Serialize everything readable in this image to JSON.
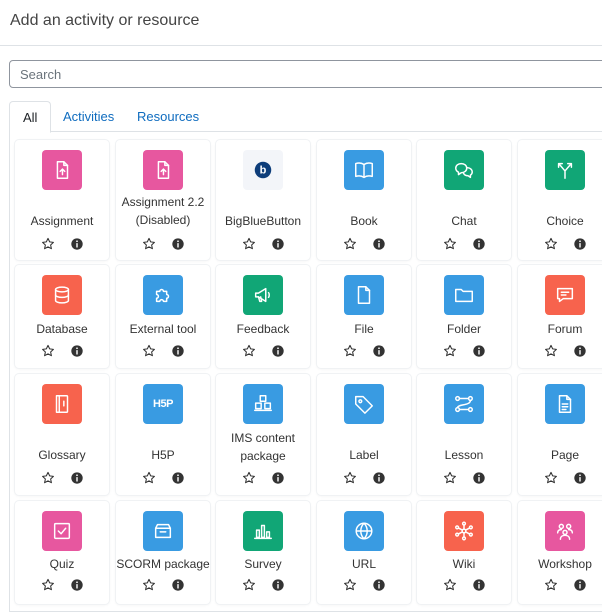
{
  "header": {
    "title": "Add an activity or resource"
  },
  "search": {
    "placeholder": "Search"
  },
  "tabs": [
    {
      "label": "All",
      "active": true
    },
    {
      "label": "Activities",
      "active": false
    },
    {
      "label": "Resources",
      "active": false
    }
  ],
  "colors": {
    "pink": "#e7579f",
    "blue": "#399be2",
    "green": "#11a676",
    "red": "#f7634d",
    "link": "#0f6cbf",
    "bbb": "#0d3d7a"
  },
  "modules": [
    {
      "label": "Assignment",
      "icon": "assignment-icon",
      "color": "pink"
    },
    {
      "label": "Assignment 2.2 (Disabled)",
      "icon": "assignment-icon",
      "color": "pink"
    },
    {
      "label": "BigBlueButton",
      "icon": "bigbluebutton-icon",
      "color": "bbb"
    },
    {
      "label": "Book",
      "icon": "book-icon",
      "color": "blue"
    },
    {
      "label": "Chat",
      "icon": "chat-icon",
      "color": "green"
    },
    {
      "label": "Choice",
      "icon": "choice-icon",
      "color": "green"
    },
    {
      "label": "Database",
      "icon": "database-icon",
      "color": "red"
    },
    {
      "label": "External tool",
      "icon": "puzzle-icon",
      "color": "blue"
    },
    {
      "label": "Feedback",
      "icon": "megaphone-icon",
      "color": "green"
    },
    {
      "label": "File",
      "icon": "file-icon",
      "color": "blue"
    },
    {
      "label": "Folder",
      "icon": "folder-icon",
      "color": "blue"
    },
    {
      "label": "Forum",
      "icon": "forum-icon",
      "color": "red"
    },
    {
      "label": "Glossary",
      "icon": "glossary-icon",
      "color": "red"
    },
    {
      "label": "H5P",
      "icon": "h5p-icon",
      "color": "blue",
      "icon_text": "H5P"
    },
    {
      "label": "IMS content package",
      "icon": "ims-package-icon",
      "color": "blue"
    },
    {
      "label": "Label",
      "icon": "tag-icon",
      "color": "blue"
    },
    {
      "label": "Lesson",
      "icon": "lesson-icon",
      "color": "blue"
    },
    {
      "label": "Page",
      "icon": "page-icon",
      "color": "blue"
    },
    {
      "label": "Quiz",
      "icon": "quiz-icon",
      "color": "pink"
    },
    {
      "label": "SCORM package",
      "icon": "scorm-icon",
      "color": "blue"
    },
    {
      "label": "Survey",
      "icon": "survey-icon",
      "color": "green"
    },
    {
      "label": "URL",
      "icon": "globe-icon",
      "color": "blue"
    },
    {
      "label": "Wiki",
      "icon": "wiki-icon",
      "color": "red"
    },
    {
      "label": "Workshop",
      "icon": "workshop-icon",
      "color": "pink"
    }
  ]
}
